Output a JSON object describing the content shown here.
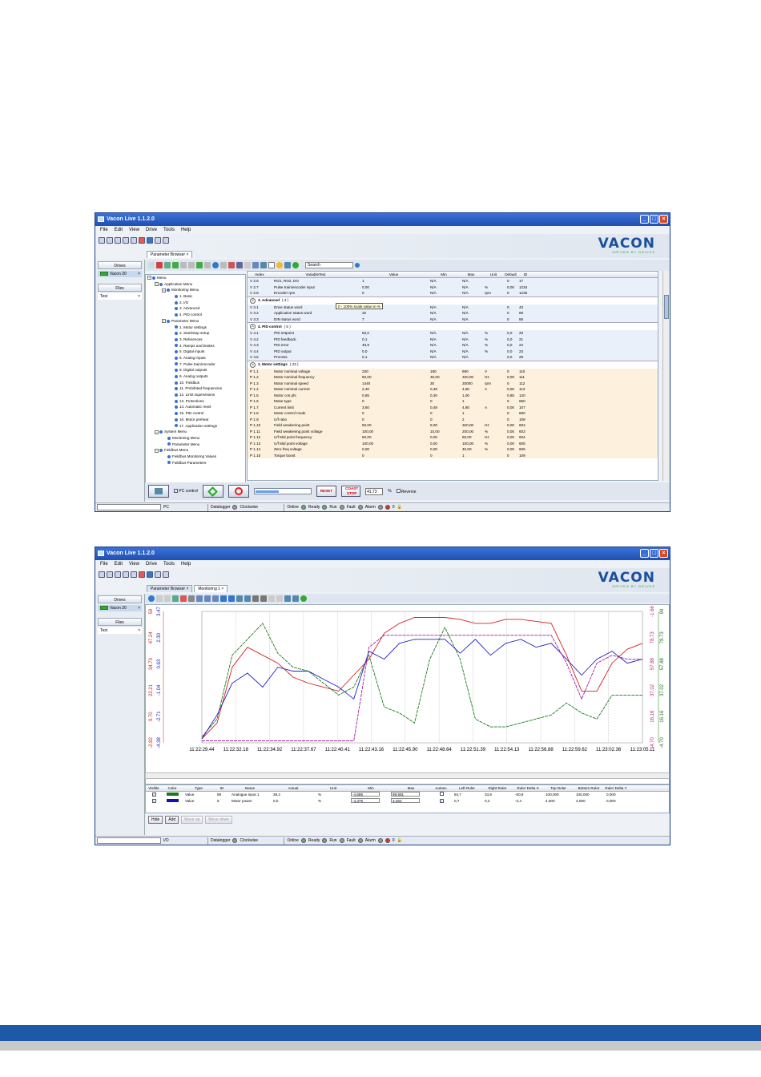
{
  "app_title": "Vacon Live 1.1.2.0",
  "menu": [
    "File",
    "Edit",
    "View",
    "Drive",
    "Tools",
    "Help"
  ],
  "logo": {
    "word": "VACON",
    "tagline": "DRIVEN BY DRIVES"
  },
  "left_pane": {
    "drives_label": "Drives",
    "drive_item": "Vacon 20",
    "files_label": "Files",
    "file_item": "Test"
  },
  "window1": {
    "tabs": [
      "Parameter Browser"
    ],
    "search_placeholder": "Search",
    "tree": [
      {
        "label": "Menu",
        "level": 0,
        "exp": "⊟"
      },
      {
        "label": "Application Menu",
        "level": 1,
        "exp": "⊟"
      },
      {
        "label": "Monitoring Menu",
        "level": 2,
        "exp": "⊟"
      },
      {
        "label": "1. Basic",
        "level": 3
      },
      {
        "label": "2. I/O",
        "level": 3
      },
      {
        "label": "3. Advanced",
        "level": 3
      },
      {
        "label": "4. PID control",
        "level": 3
      },
      {
        "label": "Parameter Menu",
        "level": 2,
        "exp": "⊟"
      },
      {
        "label": "1. Motor settings",
        "level": 3
      },
      {
        "label": "2. Start/stop setup",
        "level": 3
      },
      {
        "label": "3. References",
        "level": 3
      },
      {
        "label": "4. Ramps and brakes",
        "level": 3
      },
      {
        "label": "5. Digital inputs",
        "level": 3
      },
      {
        "label": "6. Analog inputs",
        "level": 3
      },
      {
        "label": "7. Pulse train/encoder",
        "level": 3
      },
      {
        "label": "8. Digital outputs",
        "level": 3
      },
      {
        "label": "9. Analog outputs",
        "level": 3
      },
      {
        "label": "10. Fieldbus",
        "level": 3
      },
      {
        "label": "11. Prohibited frequencies",
        "level": 3
      },
      {
        "label": "12. Limit supervisions",
        "level": 3
      },
      {
        "label": "13. Protections",
        "level": 3
      },
      {
        "label": "14. Automatic reset",
        "level": 3
      },
      {
        "label": "15. PID control",
        "level": 3
      },
      {
        "label": "16. Motor preheat",
        "level": 3
      },
      {
        "label": "17. Application settings",
        "level": 3
      },
      {
        "label": "System Menu",
        "level": 1,
        "exp": "⊟"
      },
      {
        "label": "Monitoring Menu",
        "level": 2
      },
      {
        "label": "Parameter Menu",
        "level": 2
      },
      {
        "label": "Fieldbus Menu",
        "level": 1,
        "exp": "⊟"
      },
      {
        "label": "Fieldbus Monitoring Values",
        "level": 2
      },
      {
        "label": "Fieldbus Parameters",
        "level": 2
      }
    ],
    "table_headers": [
      "Index",
      "VariableText",
      "Value",
      "Min",
      "Max",
      "Unit",
      "Default",
      "ID"
    ],
    "top_rows": [
      [
        "V 2.6",
        "RO1, RO2, DO",
        "1",
        "N/A",
        "N/A",
        "",
        "0",
        "17"
      ],
      [
        "V 2.7",
        "Pulse train/encoder input",
        "0,00",
        "N/A",
        "N/A",
        "%",
        "0,00",
        "1234"
      ],
      [
        "V 2.8",
        "Encoder rpm",
        "0",
        "N/A",
        "N/A",
        "rpm",
        "0",
        "1235"
      ]
    ],
    "tooltip": "0 - 100% scale value in %",
    "groups": [
      {
        "title": "3. Advanced",
        "count": "( 3 )",
        "style": "blue",
        "rows": [
          [
            "V 3.1",
            "Drive status word",
            "65",
            "N/A",
            "N/A",
            "",
            "0",
            "43"
          ],
          [
            "V 3.2",
            "Application status word",
            "32",
            "N/A",
            "N/A",
            "",
            "0",
            "89"
          ],
          [
            "V 3.3",
            "DIN status word",
            "7",
            "N/A",
            "N/A",
            "",
            "0",
            "56"
          ]
        ]
      },
      {
        "title": "4. PID control",
        "count": "( 5 )",
        "style": "blue",
        "rows": [
          [
            "V 4.1",
            "PID setpoint",
            "50,0",
            "N/A",
            "N/A",
            "%",
            "0,0",
            "20"
          ],
          [
            "V 4.2",
            "PID feedback",
            "0,1",
            "N/A",
            "N/A",
            "%",
            "0,0",
            "21"
          ],
          [
            "V 4.3",
            "PID error",
            "49,9",
            "N/A",
            "N/A",
            "%",
            "0,0",
            "22"
          ],
          [
            "V 4.4",
            "PID output",
            "0,0",
            "N/A",
            "N/A",
            "%",
            "0,0",
            "23"
          ],
          [
            "V 4.5",
            "Process",
            "0,1",
            "N/A",
            "N/A",
            "",
            "0,0",
            "29"
          ]
        ]
      },
      {
        "title": "1. Motor settings",
        "count": "( 23 )",
        "style": "orange",
        "rows": [
          [
            "P 1.1",
            "Motor nominal voltage",
            "230",
            "180",
            "690",
            "V",
            "0",
            "110"
          ],
          [
            "P 1.2",
            "Motor nominal frequency",
            "50,00",
            "30,00",
            "320,00",
            "Hz",
            "0,00",
            "111"
          ],
          [
            "P 1.3",
            "Motor nominal speed",
            "1440",
            "30",
            "20000",
            "rpm",
            "0",
            "112"
          ],
          [
            "P 1.4",
            "Motor nominal current",
            "2,40",
            "0,48",
            "4,80",
            "A",
            "0,00",
            "113"
          ],
          [
            "P 1.5",
            "Motor cos phi",
            "0,85",
            "0,30",
            "1,00",
            "",
            "0,85",
            "120"
          ],
          [
            "P 1.6",
            "Motor type",
            "0",
            "0",
            "1",
            "",
            "0",
            "650"
          ],
          [
            "P 1.7",
            "Current limit",
            "3,60",
            "0,48",
            "4,80",
            "A",
            "0,00",
            "107"
          ],
          [
            "P 1.8",
            "Motor control mode",
            "0",
            "0",
            "1",
            "",
            "0",
            "600"
          ],
          [
            "P 1.9",
            "U/f ratio",
            "0",
            "0",
            "2",
            "",
            "0",
            "108"
          ],
          [
            "P 1.10",
            "Field weakening point",
            "50,00",
            "8,00",
            "320,00",
            "Hz",
            "0,00",
            "602"
          ],
          [
            "P 1.11",
            "Field weakening point voltage",
            "100,00",
            "10,00",
            "200,00",
            "%",
            "0,00",
            "603"
          ],
          [
            "P 1.12",
            "U/f Mid point frequency",
            "50,00",
            "0,00",
            "50,00",
            "Hz",
            "0,00",
            "604"
          ],
          [
            "P 1.13",
            "U/f Mid point voltage",
            "100,00",
            "0,00",
            "100,00",
            "%",
            "0,00",
            "605"
          ],
          [
            "P 1.14",
            "Zero freq voltage",
            "0,00",
            "0,00",
            "40,00",
            "%",
            "0,00",
            "606"
          ],
          [
            "P 1.15",
            "Torque boost",
            "0",
            "0",
            "1",
            "",
            "0",
            "109"
          ]
        ]
      }
    ],
    "control": {
      "pc_control": "PC control",
      "reset": "RESET",
      "coast_stop": "COAST STOP",
      "speed_value": "41,73",
      "speed_unit": "%",
      "reverse": "Reverse",
      "slider_percent": 41.73
    },
    "status": {
      "location": "PC",
      "datalogger": "Datalogger",
      "direction": "Clockwise",
      "online": "Online",
      "ready": "Ready",
      "run": "Run",
      "fault": "Fault",
      "alarm": "Alarm",
      "count": "0"
    }
  },
  "window2": {
    "tabs": [
      "Parameter Browser",
      "Monitoring 1"
    ],
    "chart_data": {
      "type": "line",
      "x": [
        "11:22:29.44",
        "11:22:32.18",
        "11:22:34.92",
        "11:22:37.67",
        "11:22:40.41",
        "11:22:43.16",
        "11:22:45.90",
        "11:22:48.64",
        "11:22:51.39",
        "11:22:54.13",
        "11:22:56.88",
        "11:22:59.62",
        "11:23:02.36",
        "11:23:05.11"
      ],
      "left_axis_red": [
        "59",
        "47.24",
        "34.73",
        "22.21",
        "9.70",
        "-2.82"
      ],
      "left_axis_blue": [
        "3.47",
        "2.30",
        "0.63",
        "-1.04",
        "-2.71",
        "-4.38"
      ],
      "right_axis_pink": [
        "-1.66",
        "78.73",
        "57.88",
        "37.02",
        "16.16",
        "-4.70"
      ],
      "right_axis_green": [
        "99",
        "78.73",
        "57.88",
        "37.02",
        "16.16",
        "-4.70"
      ],
      "series": [
        {
          "color": "#d42020",
          "values": [
            2,
            10,
            38,
            48,
            44,
            40,
            33,
            30,
            28,
            26,
            34,
            42,
            55,
            60,
            63,
            63,
            63,
            62,
            60,
            60,
            62,
            62,
            61,
            60,
            44,
            26,
            26,
            40,
            47,
            50
          ]
        },
        {
          "color": "#1a7a1a",
          "values": [
            3,
            12,
            44,
            52,
            60,
            45,
            38,
            36,
            30,
            24,
            28,
            44,
            18,
            15,
            10,
            42,
            58,
            42,
            12,
            8,
            8,
            10,
            12,
            14,
            20,
            15,
            12,
            24,
            24,
            24
          ]
        },
        {
          "color": "#2020c8",
          "values": [
            2,
            14,
            30,
            35,
            28,
            38,
            36,
            36,
            32,
            28,
            22,
            46,
            42,
            50,
            52,
            52,
            52,
            45,
            52,
            44,
            50,
            52,
            48,
            50,
            42,
            34,
            42,
            46,
            40,
            42
          ]
        },
        {
          "color": "#a020a0",
          "values": [
            1,
            1,
            1,
            1,
            1,
            1,
            1,
            1,
            1,
            1,
            1,
            48,
            54,
            54,
            54,
            54,
            54,
            54,
            54,
            54,
            54,
            54,
            54,
            54,
            40,
            22,
            40,
            44,
            42,
            42
          ]
        }
      ]
    },
    "table_headers": [
      "Visible",
      "Color",
      "Type",
      "ID",
      "Name",
      "Actual",
      "Unit",
      "Min",
      "Max",
      "Autosc.",
      "Left Ruler",
      "Right Ruler",
      "Ruler Delta X",
      "Top Ruler",
      "Bottom Ruler",
      "Ruler Delta Y"
    ],
    "rows": [
      {
        "color": "#1a7a1a",
        "type": "Value",
        "id": "59",
        "name": "Analogue input 1",
        "actual": "39,2",
        "unit": "%",
        "min": "-4,695",
        "max": "99,991",
        "autosc": "",
        "left": "84,7",
        "right": "33,8",
        "dx": "-50,9",
        "top": "100,000",
        "bottom": "100,000",
        "dy": "0,000"
      },
      {
        "color": "#1010c0",
        "type": "Value",
        "id": "5",
        "name": "Motor power",
        "actual": "0,0",
        "unit": "%",
        "min": "-4,376",
        "max": "3,462",
        "autosc": "✓",
        "left": "0,7",
        "right": "0,4",
        "dx": "-2,4",
        "top": "4,000",
        "bottom": "4,000",
        "dy": "0,000"
      }
    ],
    "buttons": [
      "Hide",
      "Add",
      "Move up",
      "Move down"
    ],
    "status": {
      "location": "I/O",
      "datalogger": "Datalogger",
      "direction": "Clockwise",
      "online": "Online",
      "ready": "Ready",
      "run": "Run",
      "fault": "Fault",
      "alarm": "Alarm",
      "count": "0"
    }
  }
}
